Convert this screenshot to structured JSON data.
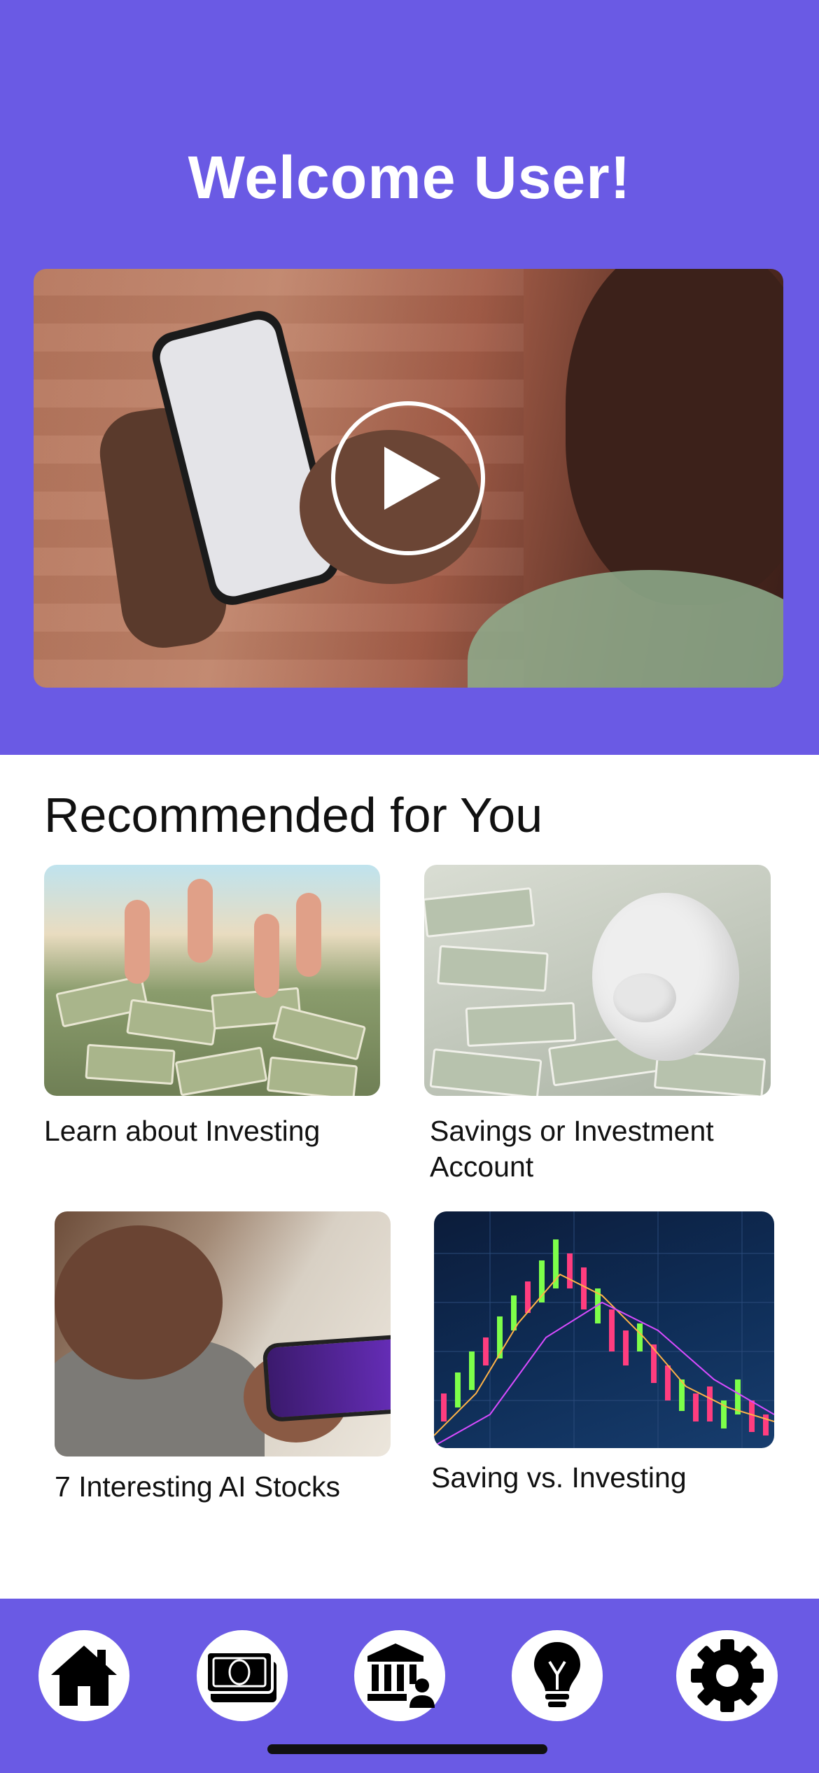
{
  "header": {
    "welcome": "Welcome User!",
    "video": {
      "play_icon": "play-icon"
    }
  },
  "recommended": {
    "title": "Recommended for You",
    "cards": [
      {
        "label": "Learn about Investing",
        "image": "thumbs-up-money-image"
      },
      {
        "label": "Savings or Investment Account",
        "image": "piggy-bank-image"
      },
      {
        "label": "7 Interesting AI Stocks",
        "image": "woman-with-phone-image"
      },
      {
        "label": "Saving vs. Investing",
        "image": "stock-chart-image"
      }
    ]
  },
  "navbar": {
    "items": [
      {
        "icon": "home-icon"
      },
      {
        "icon": "money-icon"
      },
      {
        "icon": "bank-icon"
      },
      {
        "icon": "lightbulb-icon"
      },
      {
        "icon": "gear-icon"
      }
    ]
  },
  "colors": {
    "accent": "#6a5ae4",
    "background": "#ffffff",
    "text": "#111111"
  }
}
